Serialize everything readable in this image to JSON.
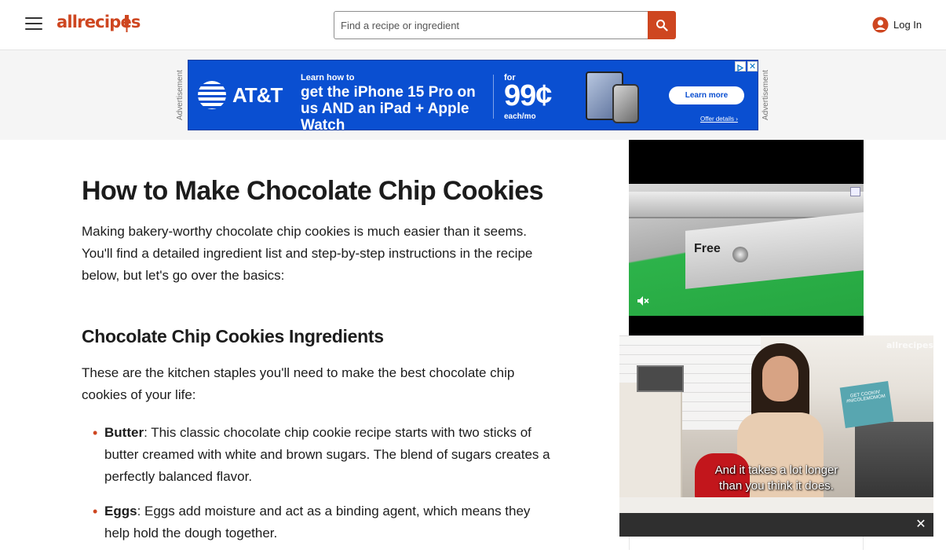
{
  "header": {
    "logo_text": "allrecipes",
    "search_placeholder": "Find a recipe or ingredient",
    "login_label": "Log In"
  },
  "ad_banner": {
    "side_label": "Advertisement",
    "brand": "AT&T",
    "pre_headline": "Learn how to",
    "headline": "get the iPhone 15 Pro on us AND an iPad + Apple Watch",
    "for_label": "for",
    "price": "99¢",
    "per": "each/mo",
    "cta": "Learn more",
    "offer_link": "Offer details ›",
    "close": "✕"
  },
  "article": {
    "title": "How to Make Chocolate Chip Cookies",
    "intro": "Making bakery-worthy chocolate chip cookies is much easier than it seems. You'll find a detailed ingredient list and step-by-step instructions in the recipe below, but let's go over the basics:",
    "ingredients_heading": "Chocolate Chip Cookies Ingredients",
    "staples_text": "These are the kitchen staples you'll need to make the best chocolate chip cookies of your life:",
    "ingredients": [
      {
        "name": "Butter",
        "text": ": This classic chocolate chip cookie recipe starts with two sticks of butter creamed with white and brown sugars. The blend of sugars creates a perfectly balanced flavor."
      },
      {
        "name": "Eggs",
        "text": ": Eggs add moisture and act as a binding agent, which means they help hold the dough together."
      }
    ]
  },
  "side_ad": {
    "overlay_text": "Free"
  },
  "video_player": {
    "caption_line1": "And it takes a lot longer",
    "caption_line2": "than you think it does.",
    "watermark": "allrecipes",
    "sign_text": "GET COOKIN' #NICOLEMOMOM",
    "close": "✕"
  },
  "colors": {
    "brand_orange": "#ce4620",
    "att_blue": "#0a4fd1"
  }
}
